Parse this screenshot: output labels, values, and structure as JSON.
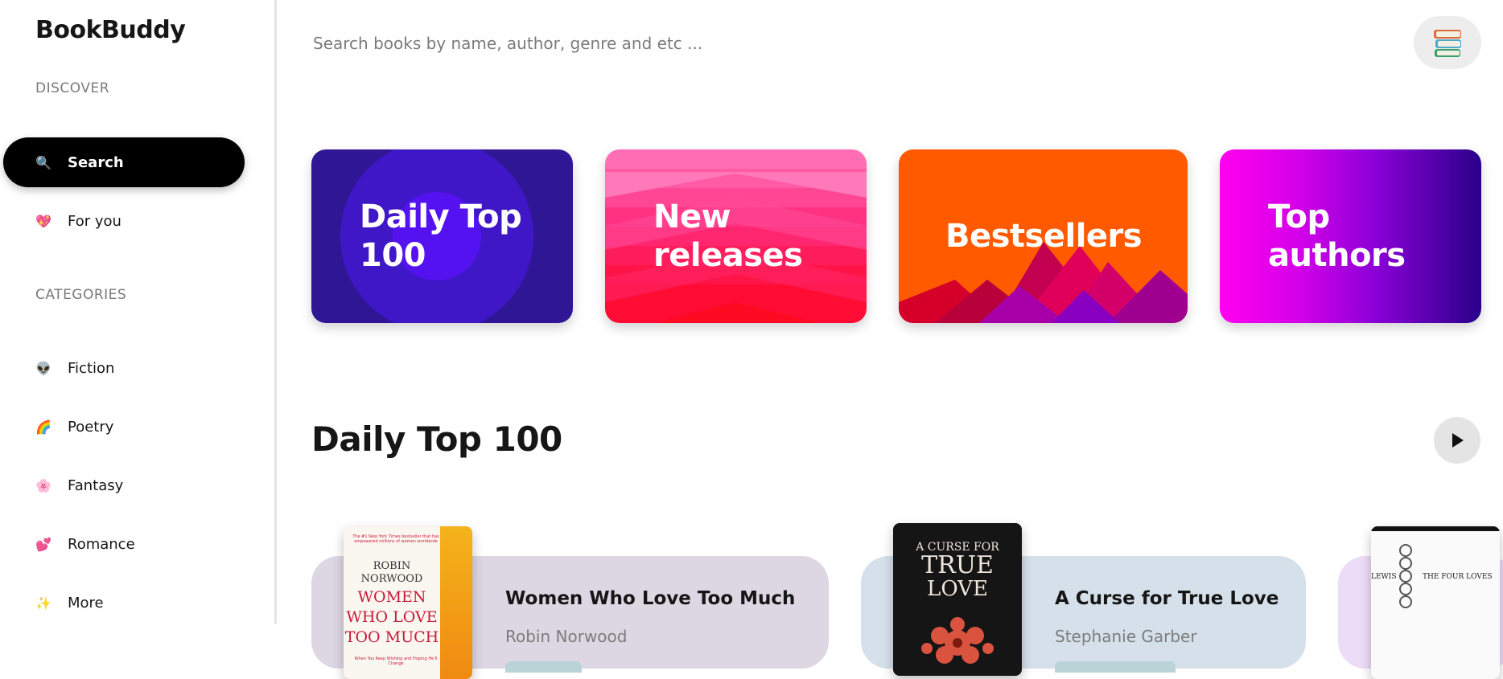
{
  "app": {
    "brand": "BookBuddy"
  },
  "sidebar": {
    "discover_label": "DISCOVER",
    "discover_items": [
      {
        "label": "Search",
        "icon": "magnifier-icon",
        "emoji": "🔍",
        "active": true
      },
      {
        "label": "For you",
        "icon": "heart-icon",
        "emoji": "💖",
        "active": false
      }
    ],
    "categories_label": "CATEGORIES",
    "category_items": [
      {
        "label": "Fiction",
        "icon": "alien-icon",
        "emoji": "👽"
      },
      {
        "label": "Poetry",
        "icon": "rainbow-icon",
        "emoji": "🌈"
      },
      {
        "label": "Fantasy",
        "icon": "flower-icon",
        "emoji": "🌸"
      },
      {
        "label": "Romance",
        "icon": "hearts-icon",
        "emoji": "💕"
      },
      {
        "label": "More",
        "icon": "sparkles-icon",
        "emoji": "✨"
      }
    ]
  },
  "search": {
    "placeholder": "Search books by name, author, genre and etc ..."
  },
  "header": {
    "avatar_icon": "books-stack-icon"
  },
  "tiles": [
    {
      "line1": "Daily Top",
      "line2": "100",
      "color": "#2f1695"
    },
    {
      "line1": "New",
      "line2": "releases",
      "color": "#ff3282"
    },
    {
      "line1": "Bestsellers",
      "line2": "",
      "color": "#ff5a00"
    },
    {
      "line1": "Top",
      "line2": "authors",
      "color": "#b800e0"
    }
  ],
  "daily_section": {
    "title": "Daily Top 100",
    "play_icon": "play-icon"
  },
  "books": [
    {
      "title": "Women Who Love Too Much",
      "author": "Robin Norwood",
      "cover": {
        "tagline": "The #1 New York Times bestseller that has empowered millions of women worldwide",
        "author_first": "ROBIN",
        "author_last": "NORWOOD",
        "title_lines": [
          "WOMEN",
          "WHO LOVE",
          "TOO MUCH"
        ],
        "subtitle": "When You Keep Wishing and Hoping He'll Change"
      }
    },
    {
      "title": "A Curse for True Love",
      "author": "Stephanie Garber",
      "cover": {
        "title_lines": [
          "A CURSE FOR",
          "TRUE",
          "LOVE"
        ]
      }
    },
    {
      "title": "",
      "author": "",
      "cover": {
        "author_fragment": "LEWIS",
        "title_line": "THE FOUR LOVES"
      }
    }
  ]
}
